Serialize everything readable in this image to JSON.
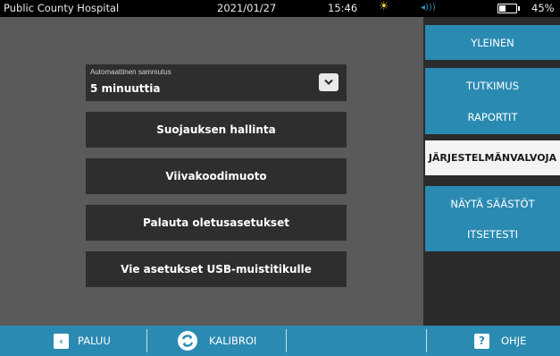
{
  "status_bar": {
    "facility": "Public County Hospital",
    "date": "2021/01/27",
    "time": "15:46",
    "battery_percent": "45%",
    "battery_level": 0.45,
    "icons": [
      "sun-icon",
      "volume-icon",
      "battery-icon"
    ]
  },
  "main": {
    "auto_shutoff": {
      "label": "Automaattinen sammutus",
      "value": "5 minuuttia"
    },
    "buttons": [
      "Suojauksen hallinta",
      "Viivakoodimuoto",
      "Palauta oletusasetukset",
      "Vie asetukset USB-muistitikulle"
    ]
  },
  "side_tabs": [
    {
      "label": "YLEINEN",
      "active": false
    },
    {
      "label": "TUTKIMUS",
      "active": false
    },
    {
      "label": "RAPORTIT",
      "active": false
    },
    {
      "label": "JÄRJESTELMÄNVALVOJA",
      "active": true
    },
    {
      "label": "NÄYTÄ SÄÄSTÖT",
      "active": false
    },
    {
      "label": "ITSETESTI",
      "active": false
    }
  ],
  "bottom_bar": {
    "back_label": "PALUU",
    "back_icon": "‹",
    "calibrate_label": "KALIBROI",
    "help_label": "OHJE",
    "help_icon": "?"
  },
  "colors": {
    "accent": "#2a8ab2",
    "main_bg": "#5a5a5a",
    "button_bg": "#2e2e2e",
    "active_tab_bg": "#f3f3f3"
  }
}
